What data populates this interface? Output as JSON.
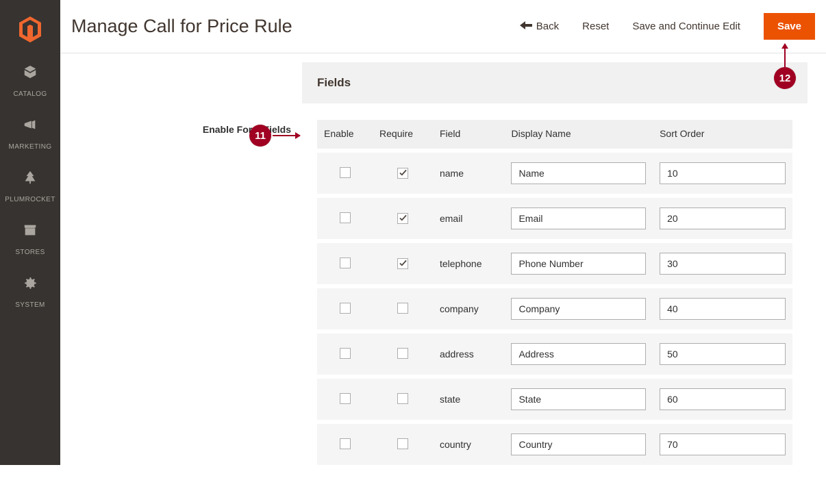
{
  "page_title": "Manage Call for Price Rule",
  "header_actions": {
    "back": "Back",
    "reset": "Reset",
    "save_continue": "Save and Continue Edit",
    "save": "Save"
  },
  "sidebar": {
    "items": [
      {
        "label": "CATALOG",
        "icon": "cube-icon"
      },
      {
        "label": "MARKETING",
        "icon": "megaphone-icon"
      },
      {
        "label": "PLUMROCKET",
        "icon": "tree-icon"
      },
      {
        "label": "STORES",
        "icon": "storefront-icon"
      },
      {
        "label": "SYSTEM",
        "icon": "gear-icon"
      }
    ]
  },
  "panel": {
    "title": "Fields",
    "field_label": "Enable Form Fields",
    "columns": {
      "enable": "Enable",
      "require": "Require",
      "field": "Field",
      "display_name": "Display Name",
      "sort_order": "Sort Order"
    },
    "rows": [
      {
        "enable": false,
        "require": true,
        "field": "name",
        "display_name": "Name",
        "sort_order": "10"
      },
      {
        "enable": false,
        "require": true,
        "field": "email",
        "display_name": "Email",
        "sort_order": "20"
      },
      {
        "enable": false,
        "require": true,
        "field": "telephone",
        "display_name": "Phone Number",
        "sort_order": "30"
      },
      {
        "enable": false,
        "require": false,
        "field": "company",
        "display_name": "Company",
        "sort_order": "40"
      },
      {
        "enable": false,
        "require": false,
        "field": "address",
        "display_name": "Address",
        "sort_order": "50"
      },
      {
        "enable": false,
        "require": false,
        "field": "state",
        "display_name": "State",
        "sort_order": "60"
      },
      {
        "enable": false,
        "require": false,
        "field": "country",
        "display_name": "Country",
        "sort_order": "70"
      }
    ]
  },
  "annotations": {
    "badge11": "11",
    "badge12": "12"
  }
}
